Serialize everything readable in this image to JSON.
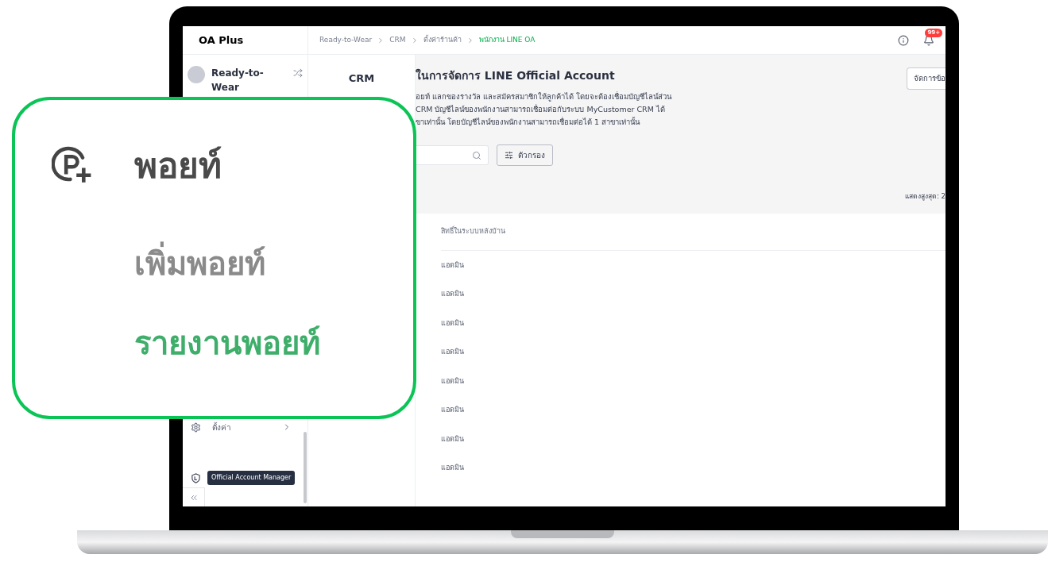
{
  "header": {
    "logo": "OA Plus",
    "breadcrumb": [
      {
        "label": "Ready-to-Wear",
        "current": false
      },
      {
        "label": "CRM",
        "current": false
      },
      {
        "label": "ตั้งค่าร้านค้า",
        "current": false
      },
      {
        "label": "พนักงาน LINE OA",
        "current": true
      }
    ],
    "notification_badge": "99+"
  },
  "sidebar": {
    "shop_name": "Ready-to-Wear",
    "items": [
      {
        "label": "ตั้งค่า"
      }
    ],
    "tooltip": "Official Account Manager"
  },
  "subnav": {
    "title": "CRM"
  },
  "main": {
    "title": "ในการจัดการ LINE Official Account",
    "description": [
      "อยท์ แลกของรางวัล และสมัครสมาชิกให้ลูกค้าได้ โดยจะต้องเชื่อมบัญชีไลน์ส่วน",
      "CRM บัญชีไลน์ของพนักงานสามารถเชื่อมต่อกับระบบ MyCustomer CRM ได้",
      "ขาเท่านั้น โดยบัญชีไลน์ของพนักงานสามารถเชื่อมต่อได้ 1 สาขาเท่านั้น"
    ],
    "manage_button": "จัดการข้อ",
    "filter_button": "ตัวกรอง",
    "max_display": "แสดงสูงสุด: 2",
    "table": {
      "columns": [
        "สิทธิ์ในระบบหลังบ้าน"
      ],
      "rows": [
        "แอดมิน",
        "แอดมิน",
        "แอดมิน",
        "แอดมิน",
        "แอดมิน",
        "แอดมิน",
        "แอดมิน",
        "แอดมิน"
      ]
    }
  },
  "callout": {
    "title": "พอยท์",
    "items": [
      {
        "label": "เพิ่มพอยท์",
        "selected": false
      },
      {
        "label": "รายงานพอยท์",
        "selected": true
      }
    ]
  }
}
